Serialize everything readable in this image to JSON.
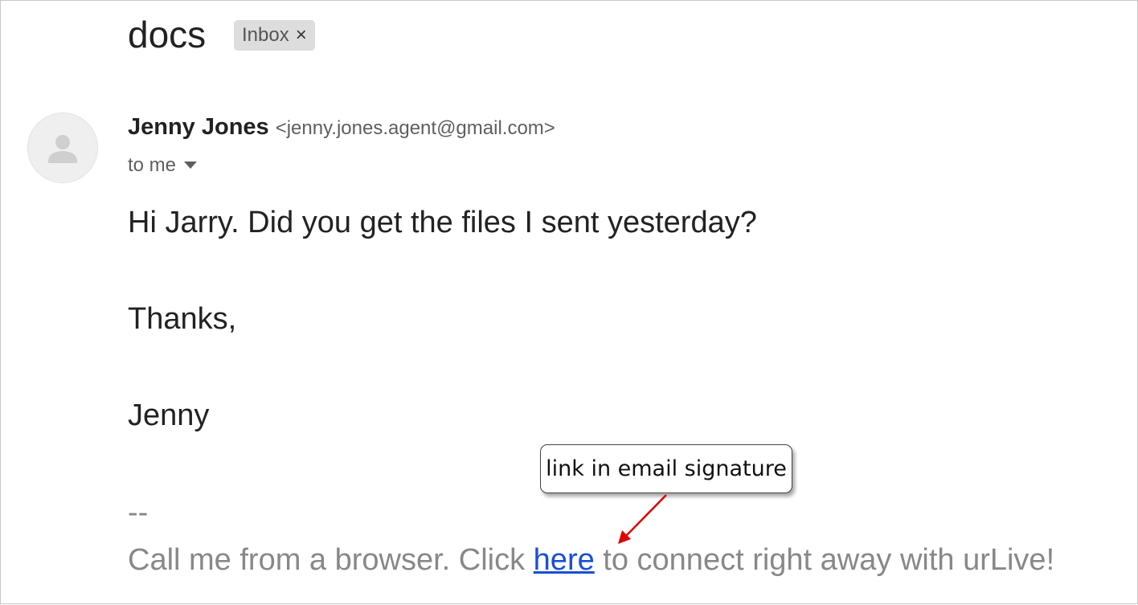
{
  "email": {
    "subject": "docs",
    "label_chip": {
      "text": "Inbox",
      "close_glyph": "×"
    },
    "avatar_icon": "person-silhouette-icon",
    "sender": {
      "name": "Jenny Jones",
      "email": "<jenny.jones.agent@gmail.com>"
    },
    "recipient": {
      "text": "to me",
      "dropdown_icon": "caret-down-icon"
    },
    "body": {
      "line1": "Hi Jarry. Did you get the files I sent yesterday?",
      "line2": "Thanks,",
      "line3": "Jenny"
    },
    "signature": {
      "separator": "--",
      "text_before": "Call me from a browser. Click ",
      "link_text": "here",
      "text_after": " to connect right away with urLive!"
    }
  },
  "annotation": {
    "callout_text": "link in email signature",
    "arrow_color": "#e00000"
  },
  "colors": {
    "link": "#1a4fd6",
    "signature_text": "#888888",
    "body_text": "#222222",
    "chip_bg": "#dddddd"
  }
}
